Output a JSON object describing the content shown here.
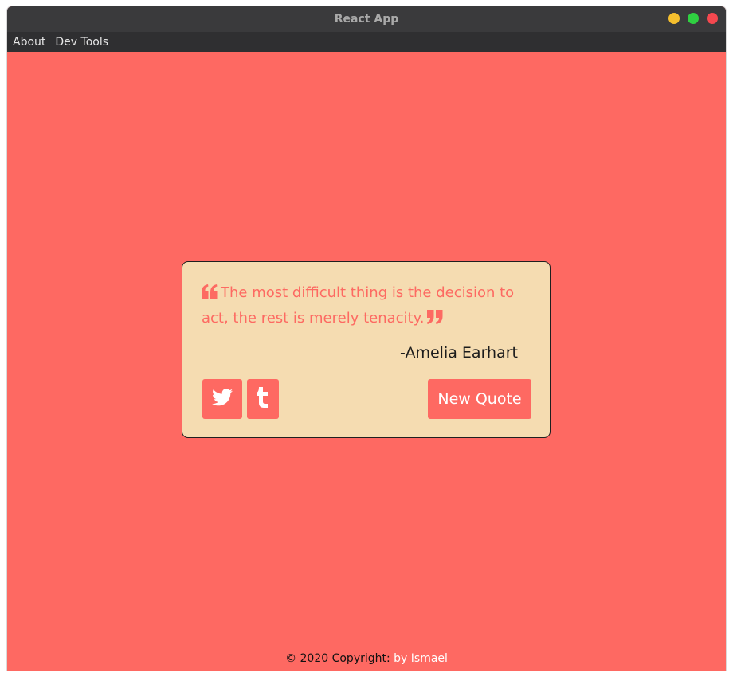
{
  "window": {
    "title": "React App"
  },
  "menu": {
    "items": [
      "About",
      "Dev Tools"
    ]
  },
  "quote": {
    "text": "The most difficult thing is the decision to act, the rest is merely tenacity.",
    "author": "-Amelia Earhart",
    "open_icon": "quote-left-icon",
    "close_icon": "quote-right-icon"
  },
  "actions": {
    "twitter_icon": "twitter-icon",
    "tumblr_icon": "tumblr-icon",
    "new_quote_label": "New Quote"
  },
  "footer": {
    "copyright": "© 2020 Copyright:",
    "author_link": "by Ismael"
  },
  "colors": {
    "background": "#fe6962",
    "card": "#f5dcb1",
    "accent": "#fe6962"
  }
}
